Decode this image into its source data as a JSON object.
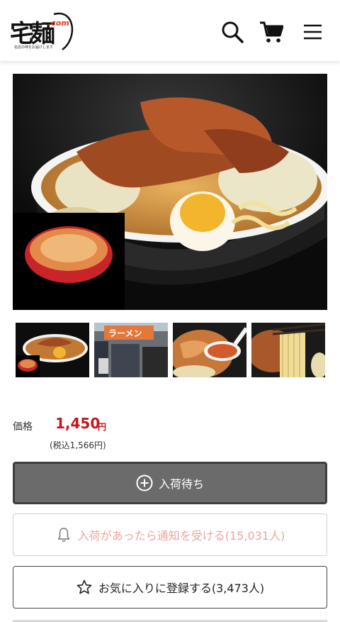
{
  "header": {
    "logo_main": "宅麺",
    "logo_com": ".com",
    "logo_tagline": "名店の味をお届けします",
    "icons": [
      "search-icon",
      "cart-icon",
      "menu-icon"
    ]
  },
  "gallery": {
    "main_image": "ramen-bowl-photo",
    "thumbnails": [
      "ramen-bowl-thumb",
      "ramen-shop-front-thumb",
      "soup-ladle-thumb",
      "noodle-lift-thumb"
    ],
    "shop_sign_text": "ラーメン"
  },
  "price": {
    "label": "価格",
    "value": "1,450",
    "unit": "円",
    "tax_included": "(税込1,566円)"
  },
  "buttons": {
    "wait_label": "入荷待ち",
    "notify_label": "入荷があったら通知を受ける(15,031人)",
    "favorite_label": "お気に入りに登録する(3,473人)"
  },
  "colors": {
    "price_red": "#c4161c",
    "wait_button_bg": "#6b6b6b",
    "notify_text": "#e9a79a"
  }
}
